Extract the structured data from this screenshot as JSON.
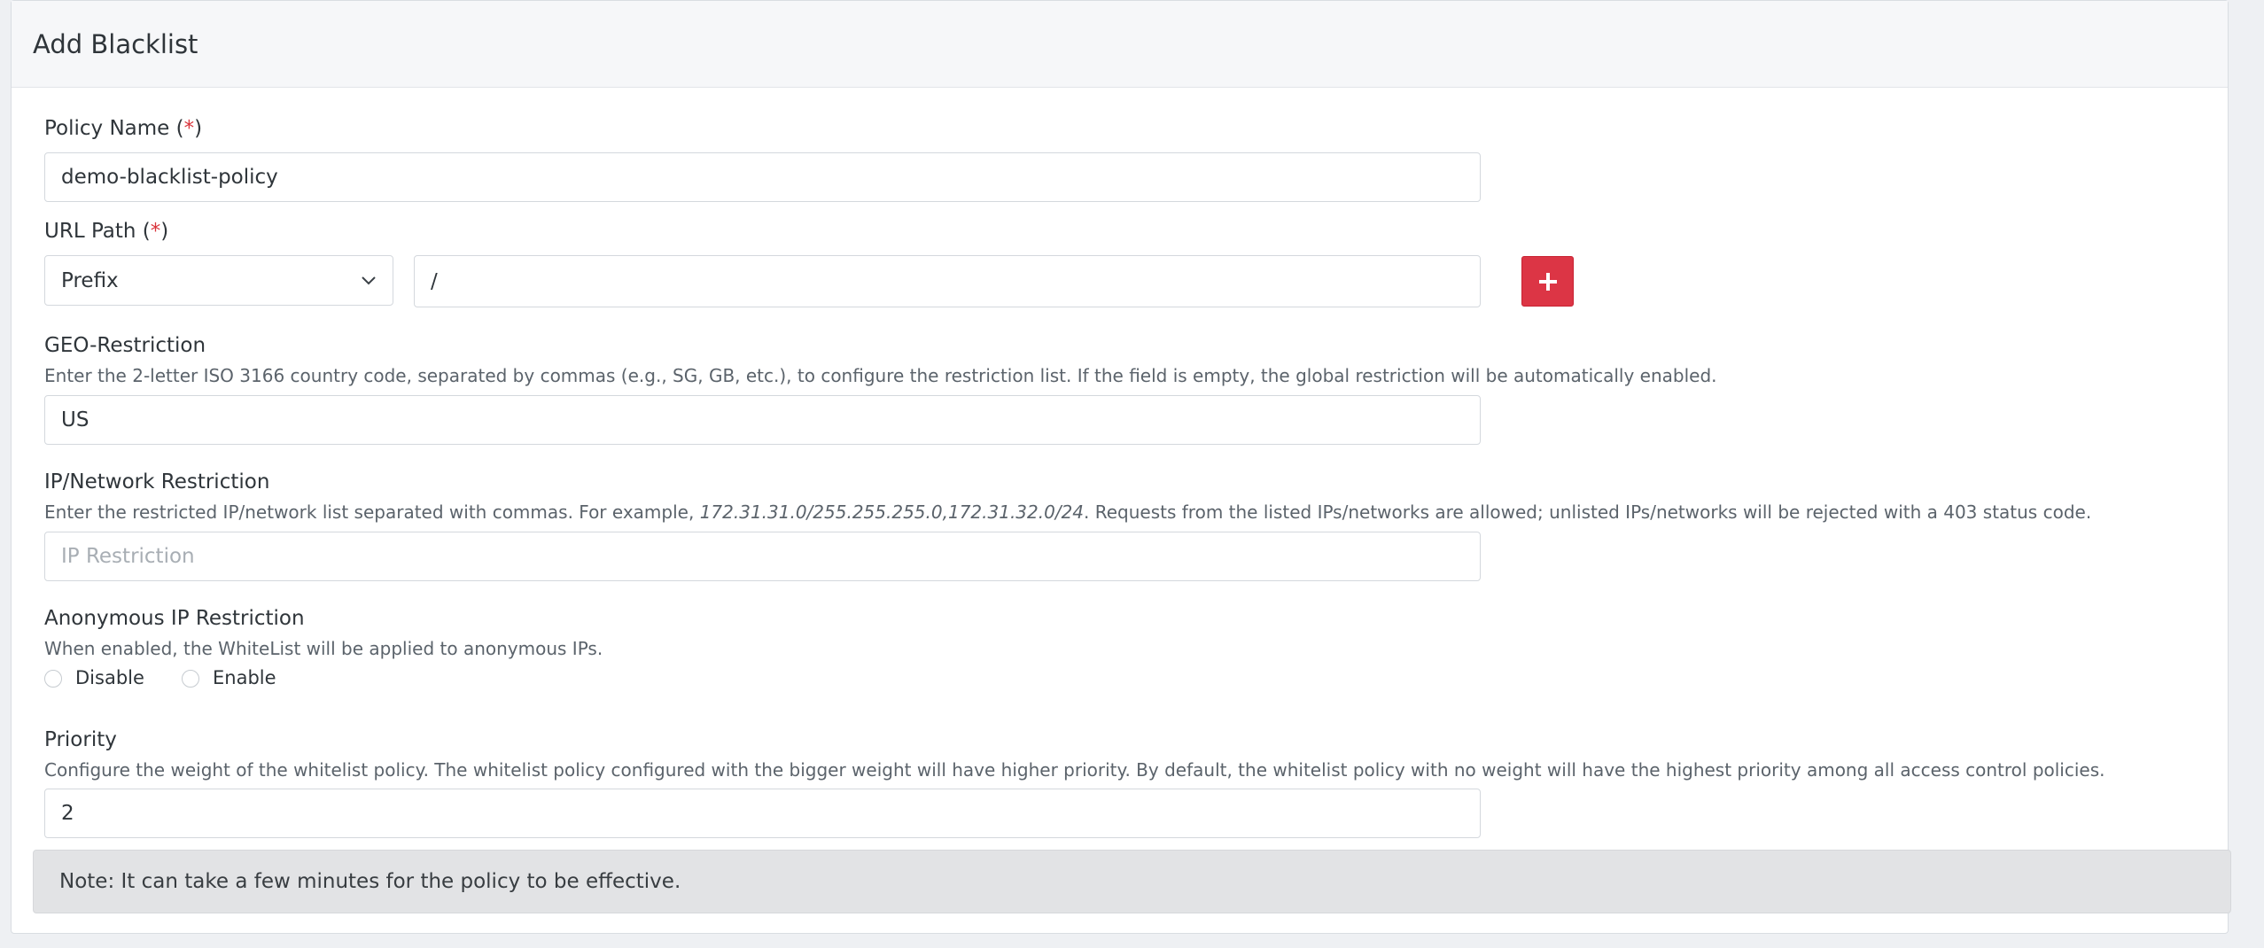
{
  "header": {
    "title": "Add Blacklist"
  },
  "policy_name": {
    "label": "Policy Name",
    "required_mark": "*",
    "value": "demo-blacklist-policy"
  },
  "url_path": {
    "label": "URL Path",
    "required_mark": "*",
    "match_type": "Prefix",
    "path_value": "/",
    "add_icon": "plus-icon"
  },
  "geo": {
    "label": "GEO-Restriction",
    "help": "Enter the 2-letter ISO 3166 country code, separated by commas (e.g., SG, GB, etc.), to configure the restriction list. If the field is empty, the global restriction will be automatically enabled.",
    "value": "US"
  },
  "ip": {
    "label": "IP/Network Restriction",
    "help_before": "Enter the restricted IP/network list separated with commas. For example, ",
    "help_example": "172.31.31.0/255.255.255.0,172.31.32.0/24",
    "help_after": ". Requests from the listed IPs/networks are allowed; unlisted IPs/networks will be rejected with a 403 status code.",
    "placeholder": "IP Restriction"
  },
  "anonymous": {
    "label": "Anonymous IP Restriction",
    "help": "When enabled, the WhiteList will be applied to anonymous IPs.",
    "options": [
      "Disable",
      "Enable"
    ]
  },
  "priority": {
    "label": "Priority",
    "help": "Configure the weight of the whitelist policy. The whitelist policy configured with the bigger weight will have higher priority. By default, the whitelist policy with no weight will have the highest priority among all access control policies.",
    "value": "2"
  },
  "note": {
    "text": "Note: It can take a few minutes for the policy to be effective."
  },
  "colors": {
    "accent": "#dc3545",
    "required": "#d9343b",
    "note_bg": "#e2e3e5"
  }
}
